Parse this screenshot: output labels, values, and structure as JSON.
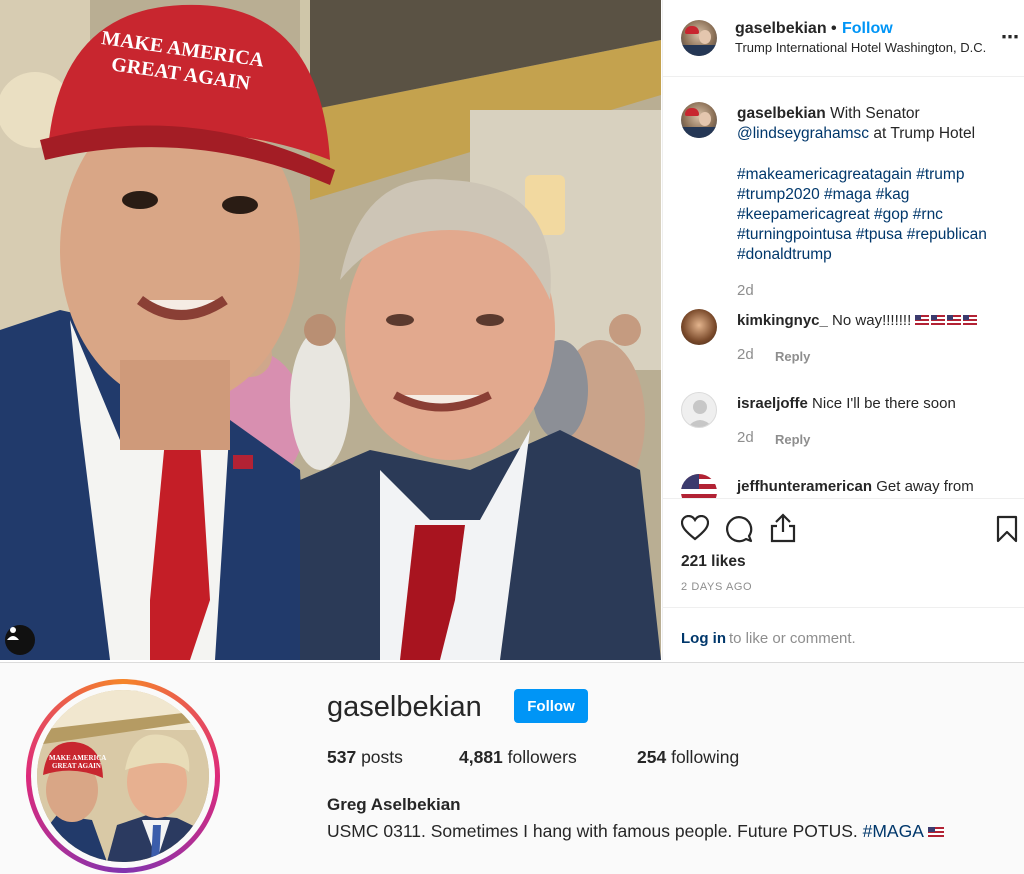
{
  "post": {
    "username": "gaselbekian",
    "separator": "•",
    "follow_label": "Follow",
    "location": "Trump International Hotel Washington, D.C.",
    "more_icon": "more-horizontal-icon",
    "caption": {
      "username": "gaselbekian",
      "text_start": "With Senator",
      "mention": "@lindseygrahamsc",
      "text_end": "at Trump Hotel",
      "hashtags_line1": "#makeamericagreatagain #trump",
      "hashtags_line2": "#trump2020 #maga #kag",
      "hashtags_line3": "#keepamericagreat #gop #rnc",
      "hashtags_line4": "#turningpointusa #tpusa #republican",
      "hashtags_line5": "#donaldtrump",
      "time": "2d"
    },
    "comments": [
      {
        "username": "kimkingnyc_",
        "text": "No way!!!!!!!",
        "emoji": "us-flag-emoji x4",
        "time": "2d",
        "reply": "Reply"
      },
      {
        "username": "israeljoffe",
        "text": "Nice I'll be there soon",
        "time": "2d",
        "reply": "Reply"
      },
      {
        "username": "jeffhunteramerican",
        "text": "Get away from"
      }
    ],
    "likes": "221 likes",
    "posted": "2 DAYS AGO",
    "login_link": "Log in",
    "login_rest": "to like or comment."
  },
  "photo": {
    "cap_text_line1": "MAKE AMERICA",
    "cap_text_line2": "GREAT AGAIN"
  },
  "profile": {
    "username": "gaselbekian",
    "follow_label": "Follow",
    "posts_count": "537",
    "posts_label": "posts",
    "followers_count": "4,881",
    "followers_label": "followers",
    "following_count": "254",
    "following_label": "following",
    "full_name": "Greg Aselbekian",
    "bio": "USMC 0311. Sometimes I hang with famous people. Future POTUS.",
    "bio_tag": "#MAGA",
    "profile_pic_cap_line1": "MAKE AMERICA",
    "profile_pic_cap_line2": "GREAT AGAIN"
  },
  "colors": {
    "accent_blue": "#0095f6",
    "link_blue": "#00376b",
    "muted": "#8e8e8e",
    "cap_red": "#c8262f"
  }
}
